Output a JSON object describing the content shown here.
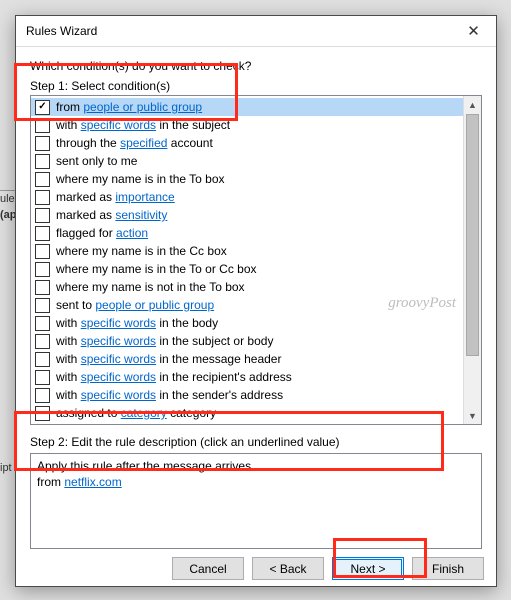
{
  "window": {
    "title": "Rules Wizard"
  },
  "prompt": "Which condition(s) do you want to check?",
  "step1_label": "Step 1: Select condition(s)",
  "conditions": [
    {
      "checked": true,
      "selected": true,
      "parts": [
        {
          "t": "from "
        },
        {
          "t": "people or public group",
          "link": true
        }
      ]
    },
    {
      "checked": false,
      "selected": false,
      "parts": [
        {
          "t": "with "
        },
        {
          "t": "specific words",
          "link": true
        },
        {
          "t": " in the subject"
        }
      ]
    },
    {
      "checked": false,
      "selected": false,
      "parts": [
        {
          "t": "through the "
        },
        {
          "t": "specified",
          "link": true
        },
        {
          "t": " account"
        }
      ]
    },
    {
      "checked": false,
      "selected": false,
      "parts": [
        {
          "t": "sent only to me"
        }
      ]
    },
    {
      "checked": false,
      "selected": false,
      "parts": [
        {
          "t": "where my name is in the To box"
        }
      ]
    },
    {
      "checked": false,
      "selected": false,
      "parts": [
        {
          "t": "marked as "
        },
        {
          "t": "importance",
          "link": true
        }
      ]
    },
    {
      "checked": false,
      "selected": false,
      "parts": [
        {
          "t": "marked as "
        },
        {
          "t": "sensitivity",
          "link": true
        }
      ]
    },
    {
      "checked": false,
      "selected": false,
      "parts": [
        {
          "t": "flagged for "
        },
        {
          "t": "action",
          "link": true
        }
      ]
    },
    {
      "checked": false,
      "selected": false,
      "parts": [
        {
          "t": "where my name is in the Cc box"
        }
      ]
    },
    {
      "checked": false,
      "selected": false,
      "parts": [
        {
          "t": "where my name is in the To or Cc box"
        }
      ]
    },
    {
      "checked": false,
      "selected": false,
      "parts": [
        {
          "t": "where my name is not in the To box"
        }
      ]
    },
    {
      "checked": false,
      "selected": false,
      "parts": [
        {
          "t": "sent to "
        },
        {
          "t": "people or public group",
          "link": true
        }
      ]
    },
    {
      "checked": false,
      "selected": false,
      "parts": [
        {
          "t": "with "
        },
        {
          "t": "specific words",
          "link": true
        },
        {
          "t": " in the body"
        }
      ]
    },
    {
      "checked": false,
      "selected": false,
      "parts": [
        {
          "t": "with "
        },
        {
          "t": "specific words",
          "link": true
        },
        {
          "t": " in the subject or body"
        }
      ]
    },
    {
      "checked": false,
      "selected": false,
      "parts": [
        {
          "t": "with "
        },
        {
          "t": "specific words",
          "link": true
        },
        {
          "t": " in the message header"
        }
      ]
    },
    {
      "checked": false,
      "selected": false,
      "parts": [
        {
          "t": "with "
        },
        {
          "t": "specific words",
          "link": true
        },
        {
          "t": " in the recipient's address"
        }
      ]
    },
    {
      "checked": false,
      "selected": false,
      "parts": [
        {
          "t": "with "
        },
        {
          "t": "specific words",
          "link": true
        },
        {
          "t": " in the sender's address"
        }
      ]
    },
    {
      "checked": false,
      "selected": false,
      "parts": [
        {
          "t": "assigned to "
        },
        {
          "t": "category",
          "link": true
        },
        {
          "t": " category"
        }
      ]
    }
  ],
  "step2_label": "Step 2: Edit the rule description (click an underlined value)",
  "description": {
    "line1": "Apply this rule after the message arrives",
    "line2_prefix": "from ",
    "line2_link": "netflix.com"
  },
  "buttons": {
    "cancel": "Cancel",
    "back": "< Back",
    "next": "Next >",
    "finish": "Finish"
  },
  "bg": {
    "rule": "ule",
    "ap": "(ap",
    "ipt": "ipt"
  },
  "watermark": "groovyPost"
}
